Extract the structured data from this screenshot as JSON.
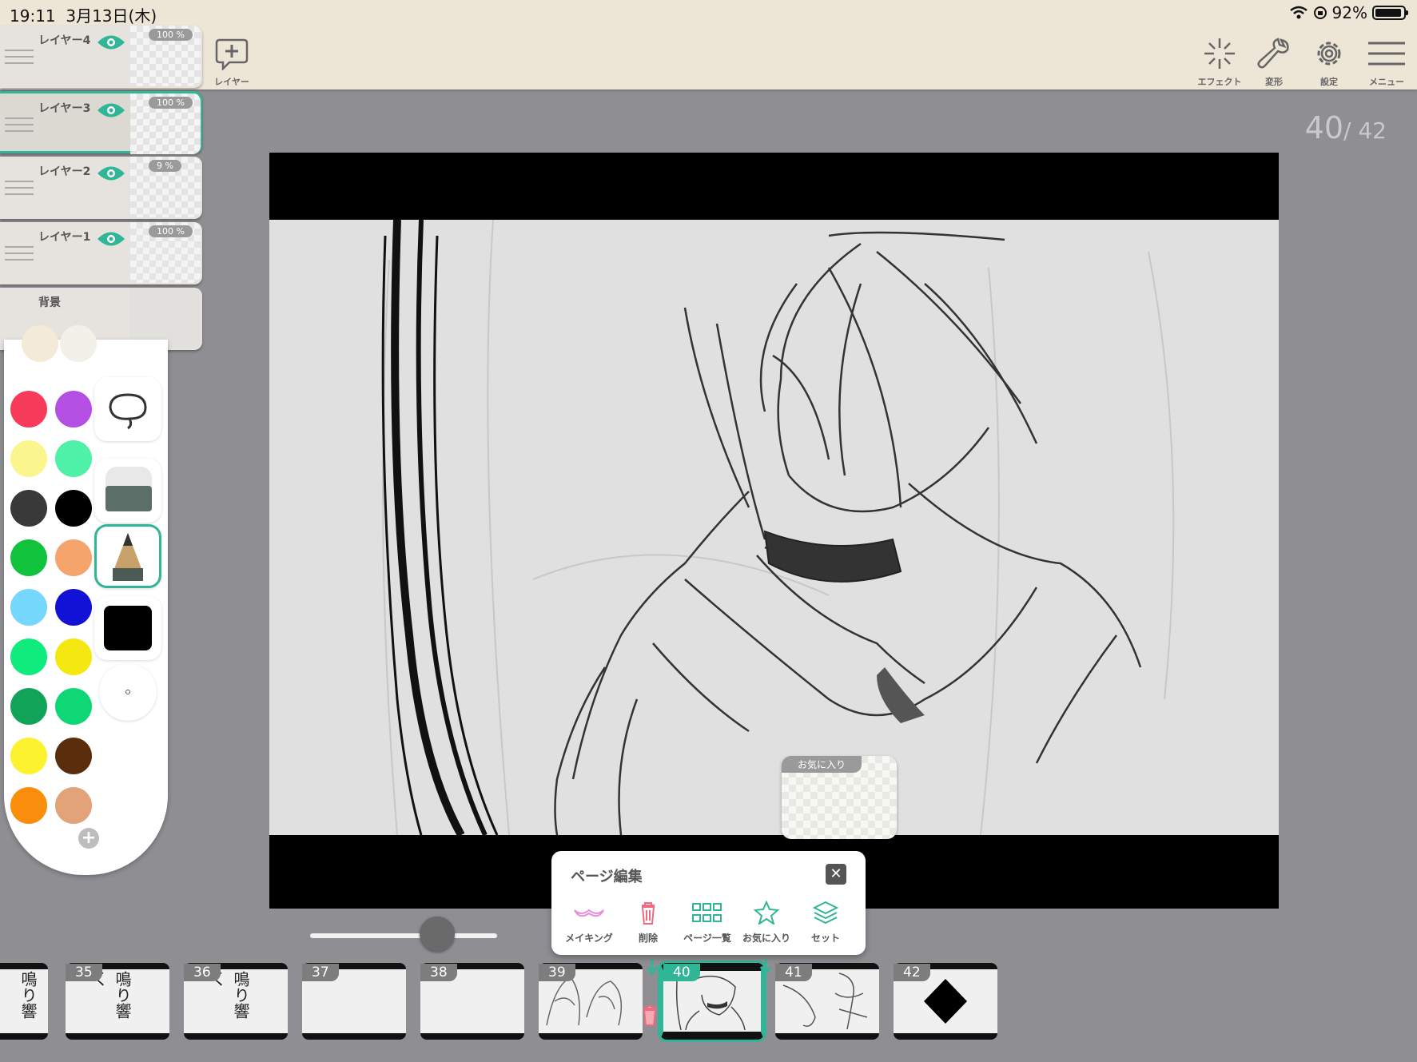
{
  "status_bar": {
    "time": "19:11",
    "date": "3月13日(木)",
    "battery": "92%"
  },
  "toolbar": {
    "add_layer_label": "レイヤー",
    "effect_label": "エフェクト",
    "transform_label": "変形",
    "settings_label": "設定",
    "menu_label": "メニュー"
  },
  "layers": [
    {
      "name": "レイヤー4",
      "opacity": "100 %",
      "active": false
    },
    {
      "name": "レイヤー3",
      "opacity": "100 %",
      "active": true
    },
    {
      "name": "レイヤー2",
      "opacity": "9 %",
      "active": false
    },
    {
      "name": "レイヤー1",
      "opacity": "100 %",
      "active": false
    },
    {
      "name": "背景",
      "opacity": "",
      "active": false
    }
  ],
  "palette": {
    "colors": [
      "#f73b59",
      "#b44fe3",
      "#fbf58e",
      "#4ff0a7",
      "#393939",
      "#000000",
      "#11c23c",
      "#f5a46b",
      "#75d7fb",
      "#1212d6",
      "#10eb7d",
      "#f5e710",
      "#11a458",
      "#10d775",
      "#fcf230",
      "#5a2e0c",
      "#fa8d0c",
      "#e2a27a"
    ],
    "tools": [
      "lasso-tool",
      "eraser-tool",
      "pencil-tool",
      "color-black",
      "brush-size"
    ],
    "active_tool": "pencil-tool",
    "current_color": "#000000"
  },
  "page_counter": {
    "current": "40",
    "total": "/ 42"
  },
  "favorite_popup": {
    "label": "お気に入り"
  },
  "page_edit": {
    "title": "ページ編集",
    "actions": [
      {
        "label": "メイキング",
        "icon": "mustache-icon"
      },
      {
        "label": "削除",
        "icon": "trash-icon"
      },
      {
        "label": "ページ一覧",
        "icon": "grid-icon"
      },
      {
        "label": "お気に入り",
        "icon": "star-icon"
      },
      {
        "label": "セット",
        "icon": "layers-icon"
      }
    ]
  },
  "zoom_slider": {
    "value": 0.68
  },
  "pages": [
    {
      "num": "",
      "text": "鳴り響"
    },
    {
      "num": "35",
      "text": "鳴り響く"
    },
    {
      "num": "36",
      "text": "鳴り響く"
    },
    {
      "num": "37",
      "text": ""
    },
    {
      "num": "38",
      "text": ""
    },
    {
      "num": "39",
      "text": ""
    },
    {
      "num": "40",
      "text": "",
      "current": true
    },
    {
      "num": "41",
      "text": ""
    },
    {
      "num": "42",
      "text": ""
    }
  ]
}
